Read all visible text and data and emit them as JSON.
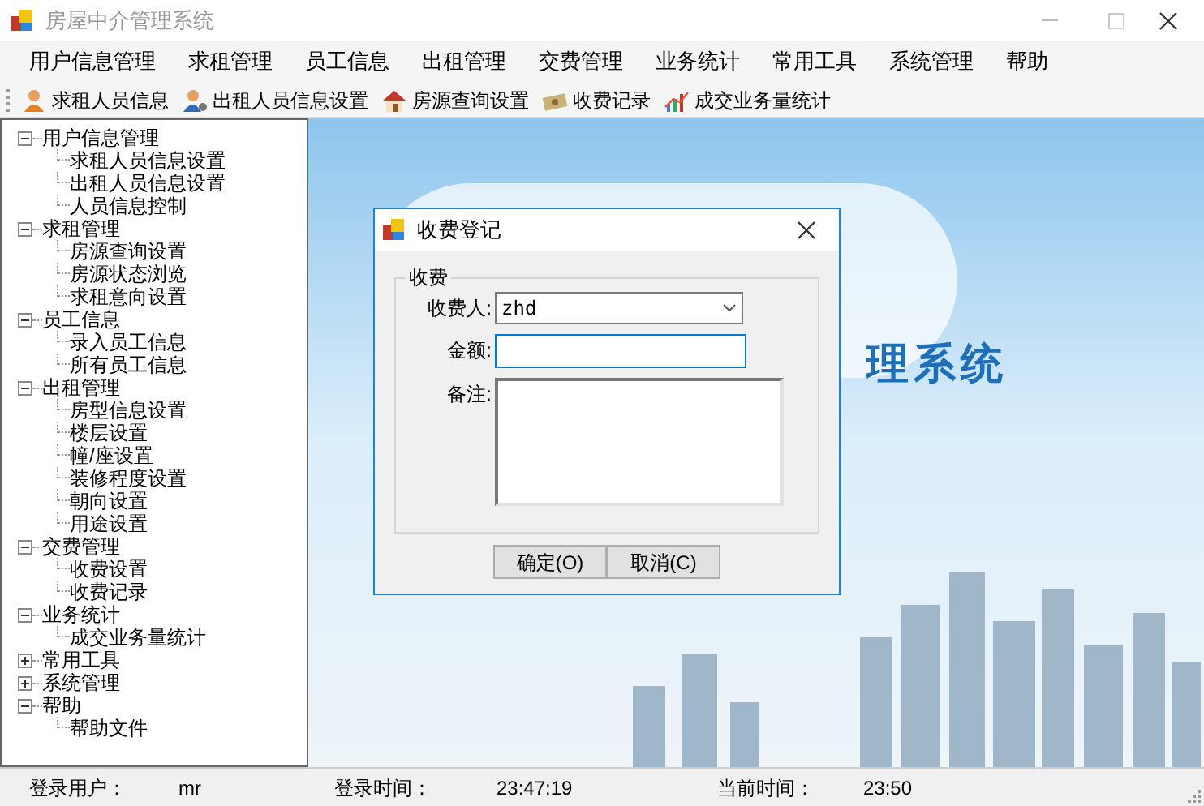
{
  "window": {
    "title": "房屋中介管理系统"
  },
  "menu": [
    "用户信息管理",
    "求租管理",
    "员工信息",
    "出租管理",
    "交费管理",
    "业务统计",
    "常用工具",
    "系统管理",
    "帮助"
  ],
  "toolbar": [
    {
      "label": "求租人员信息",
      "kind": "person"
    },
    {
      "label": "出租人员信息设置",
      "kind": "person-settings"
    },
    {
      "label": "房源查询设置",
      "kind": "house"
    },
    {
      "label": "收费记录",
      "kind": "money"
    },
    {
      "label": "成交业务量统计",
      "kind": "chart"
    }
  ],
  "tree": [
    {
      "label": "用户信息管理",
      "expanded": true,
      "children": [
        {
          "label": "求租人员信息设置"
        },
        {
          "label": "出租人员信息设置"
        },
        {
          "label": "人员信息控制"
        }
      ]
    },
    {
      "label": "求租管理",
      "expanded": true,
      "children": [
        {
          "label": "房源查询设置"
        },
        {
          "label": "房源状态浏览"
        },
        {
          "label": "求租意向设置"
        }
      ]
    },
    {
      "label": "员工信息",
      "expanded": true,
      "children": [
        {
          "label": "录入员工信息"
        },
        {
          "label": "所有员工信息"
        }
      ]
    },
    {
      "label": "出租管理",
      "expanded": true,
      "children": [
        {
          "label": "房型信息设置"
        },
        {
          "label": "楼层设置"
        },
        {
          "label": "幢/座设置"
        },
        {
          "label": "装修程度设置"
        },
        {
          "label": "朝向设置"
        },
        {
          "label": "用途设置"
        }
      ]
    },
    {
      "label": "交费管理",
      "expanded": true,
      "children": [
        {
          "label": "收费设置"
        },
        {
          "label": "收费记录"
        }
      ]
    },
    {
      "label": "业务统计",
      "expanded": true,
      "children": [
        {
          "label": "成交业务量统计"
        }
      ]
    },
    {
      "label": "常用工具",
      "expanded": false
    },
    {
      "label": "系统管理",
      "expanded": false
    },
    {
      "label": "帮助",
      "expanded": true,
      "children": [
        {
          "label": "帮助文件"
        }
      ]
    }
  ],
  "background": {
    "caption": "理系统"
  },
  "dialog": {
    "title": "收费登记",
    "group": "收费",
    "fields": [
      {
        "label": "收费人:",
        "kind": "dropdown",
        "value": "zhd",
        "focused": false
      },
      {
        "label": "金额:",
        "kind": "text",
        "focused": true
      },
      {
        "label": "备注:",
        "kind": "textarea",
        "focused": false
      }
    ],
    "buttons": [
      "确定(O)",
      "取消(C)"
    ]
  },
  "status_bar": [
    {
      "label": "登录用户：",
      "value": "mr"
    },
    {
      "label": "登录时间：",
      "value": "23:47:19"
    },
    {
      "label": "当前时间：",
      "value": "23:50"
    }
  ]
}
